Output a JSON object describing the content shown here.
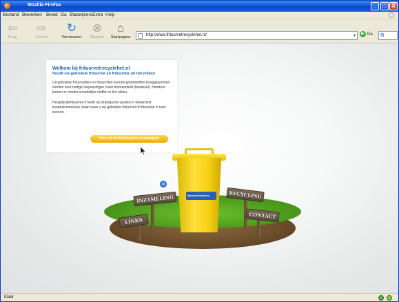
{
  "window": {
    "title": "Mozilla Firefox",
    "buttons": {
      "minimize": "_",
      "maximize": "□",
      "close": "X"
    }
  },
  "menu": {
    "items": [
      "Bestand",
      "Bewerken",
      "Beeld",
      "Ga",
      "Bladwijzers",
      "Extra",
      "Help"
    ]
  },
  "toolbar": {
    "back_label": "Terug",
    "forward_label": "Vooruit",
    "reload_label": "Vernieuwen",
    "stop_label": "Stoppen",
    "home_label": "Startpagina"
  },
  "address": {
    "url": "http://www.frituurvetrecyclehet.nl/",
    "go_label": "Ga"
  },
  "icons": {
    "back": "arrow-left-icon",
    "forward": "arrow-right-icon",
    "reload": "reload-icon",
    "stop": "stop-icon",
    "home": "home-icon",
    "search_engine": "google-icon"
  },
  "page": {
    "heading": "Welkom bij frituurvetrecyclehet.nl",
    "subheading": "Houdt uw gebruikte frituurvet en frituurolie uit het milieu!",
    "paragraph1": "Uit gebruikte frituurvetten en frituuroliën kunnen grondstoffen teruggewonnen worden voor nuttige toepassingen zoals biobrandstof (biodiesel). Hierdoor komen er minder schadelijke stoffen in het milieu.",
    "paragraph2": "Hergebruikfrituurvet.nl heeft op strategische punten in Nederland inzamelcontainers staan waar u uw gebruikte frituurvet of frituurolie in kunt leveren.",
    "cta_label": "Vind uw dichtstbijzijnde inzamelpunt",
    "bin_sticker": "frituurvet inleveren",
    "signs": {
      "left_upper": "INZAMELING",
      "left_lower": "LINKS",
      "right_upper": "RECYCLING",
      "right_lower": "CONTACT"
    }
  },
  "status": {
    "text": "Klaar"
  },
  "colors": {
    "titlebar": "#1656d9",
    "chrome": "#ece9d8",
    "link_blue": "#1c5ea8",
    "cta_yellow": "#f2a90c",
    "bin_yellow": "#ffe03a",
    "grass_green": "#4f9e1e"
  }
}
